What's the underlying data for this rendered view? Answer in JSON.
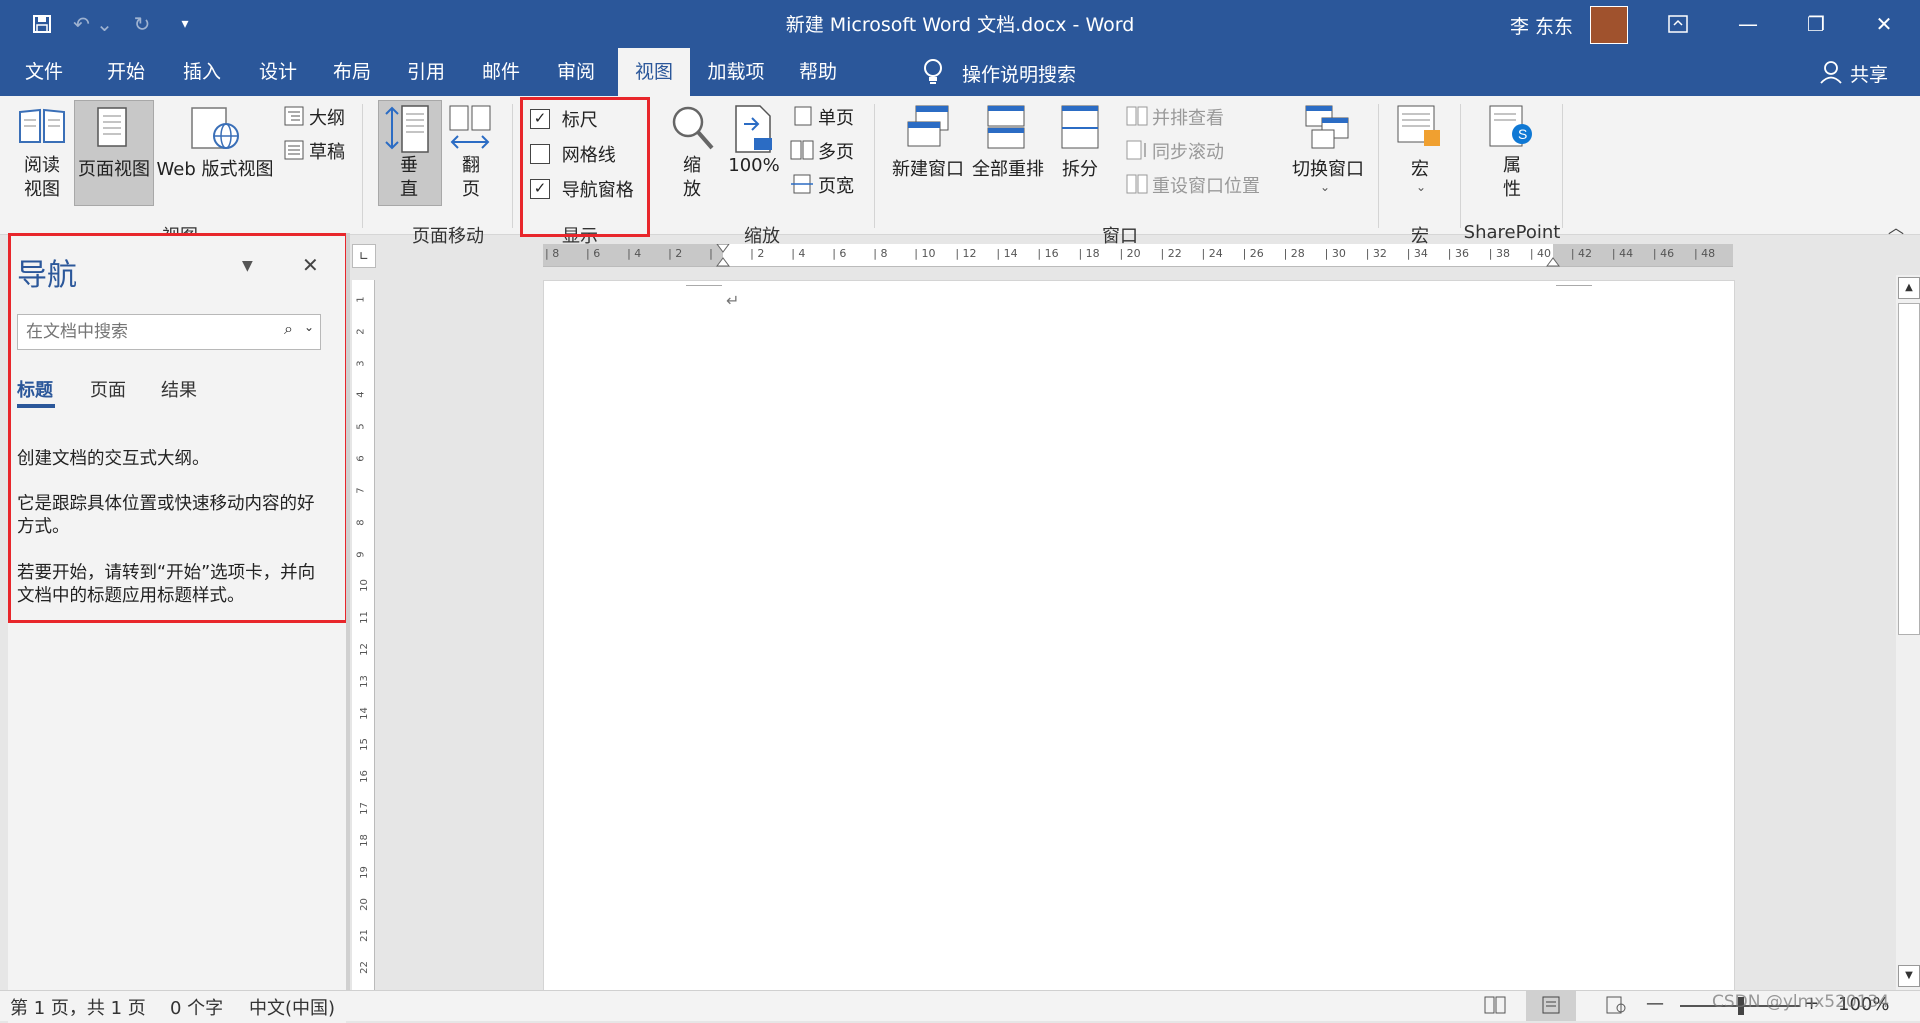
{
  "window": {
    "title": "新建 Microsoft Word 文档.docx  -  Word",
    "user_name": "李 东东",
    "qat_icons": [
      "save-icon",
      "undo-icon",
      "redo-icon",
      "customize-qat-icon"
    ],
    "window_buttons": [
      "ribbon-display-options-icon",
      "minimize-icon",
      "restore-icon",
      "close-icon"
    ]
  },
  "menu": {
    "tabs": [
      "文件",
      "开始",
      "插入",
      "设计",
      "布局",
      "引用",
      "邮件",
      "审阅",
      "视图",
      "加载项",
      "帮助"
    ],
    "active_tab": "视图",
    "tell_me": "操作说明搜索",
    "share": "共享"
  },
  "ribbon": {
    "views": {
      "group": "视图",
      "read_mode": "阅读\n视图",
      "print_layout": "页面视图",
      "web_layout": "Web 版式视图",
      "outline": "大纲",
      "draft": "草稿"
    },
    "page_movement": {
      "group": "页面移动",
      "vertical": "垂\n直",
      "side_to_side": "翻\n页"
    },
    "show": {
      "group": "显示",
      "ruler": "标尺",
      "ruler_checked": true,
      "gridlines": "网格线",
      "gridlines_checked": false,
      "nav_pane": "导航窗格",
      "nav_pane_checked": true
    },
    "zoom": {
      "group": "缩放",
      "zoom": "缩\n放",
      "hundred": "100%",
      "one_page": "单页",
      "multiple_pages": "多页",
      "page_width": "页宽"
    },
    "window": {
      "group": "窗口",
      "new_window": "新建窗口",
      "arrange_all": "全部重排",
      "split": "拆分",
      "side_by_side": "并排查看",
      "sync_scroll": "同步滚动",
      "reset_position": "重设窗口位置",
      "switch_windows": "切换窗口"
    },
    "macros": {
      "group": "宏",
      "macros": "宏"
    },
    "sharepoint": {
      "group": "SharePoint",
      "properties": "属\n性"
    }
  },
  "nav_pane": {
    "title": "导航",
    "search_placeholder": "在文档中搜索",
    "tabs": [
      "标题",
      "页面",
      "结果"
    ],
    "active_tab": "标题",
    "text1": "创建文档的交互式大纲。",
    "text2": "它是跟踪具体位置或快速移动内容的好方式。",
    "text3": "若要开始，请转到“开始”选项卡，并向文档中的标题应用标题样式。"
  },
  "ruler": {
    "h_ticks": [
      "8",
      "6",
      "4",
      "2",
      "",
      "2",
      "4",
      "6",
      "8",
      "10",
      "12",
      "14",
      "16",
      "18",
      "20",
      "22",
      "24",
      "26",
      "28",
      "30",
      "32",
      "34",
      "36",
      "38",
      "40",
      "42",
      "44",
      "46",
      "48"
    ],
    "v_ticks": [
      "1",
      "2",
      "3",
      "4",
      "5",
      "6",
      "7",
      "8",
      "9",
      "10",
      "11",
      "12",
      "13",
      "14",
      "15",
      "16",
      "17",
      "18",
      "19",
      "20",
      "21",
      "22"
    ]
  },
  "status": {
    "page": "第 1 页，共 1 页",
    "words": "0 个字",
    "language": "中文(中国)",
    "zoom": "100%",
    "watermark": "CSDN @ylmx520134"
  },
  "colors": {
    "title_bar": "#2b579a",
    "highlight": "#e8262b",
    "ribbon_bg": "#f3f3f3"
  }
}
